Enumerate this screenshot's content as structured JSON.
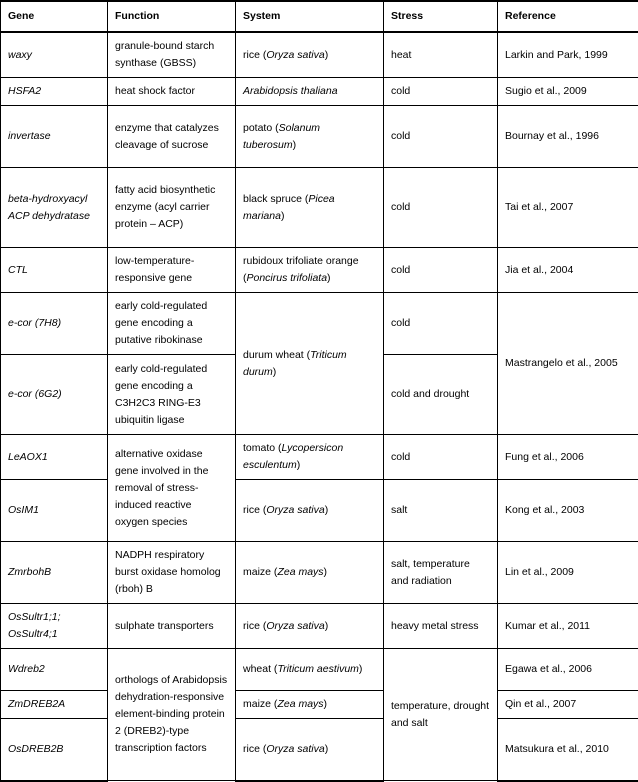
{
  "table": {
    "columns": [
      {
        "key": "gene",
        "label": "Gene"
      },
      {
        "key": "function",
        "label": "Function"
      },
      {
        "key": "system",
        "label": "System"
      },
      {
        "key": "stress",
        "label": "Stress"
      },
      {
        "key": "reference",
        "label": "Reference"
      }
    ],
    "rows": [
      {
        "gene": "waxy",
        "function": "granule-bound starch synthase (GBSS)",
        "system_plain": "rice (",
        "system_italic": "Oryza sativa",
        "system_tail": ")",
        "stress": "heat",
        "reference": "Larkin and Park, 1999"
      },
      {
        "gene": "HSFA2",
        "function": "heat shock factor",
        "system_plain": "",
        "system_italic": "Arabidopsis thaliana",
        "system_tail": "",
        "stress": "cold",
        "reference": "Sugio et al., 2009"
      },
      {
        "gene": "invertase",
        "function": "enzyme that catalyzes cleavage of sucrose",
        "system_plain": "potato (",
        "system_italic": "Solanum tuberosum",
        "system_tail": ")",
        "stress": "cold",
        "reference": "Bournay et al., 1996"
      },
      {
        "gene": "beta-hydroxyacyl ACP dehydratase",
        "function": "fatty acid biosynthetic enzyme (acyl carrier protein – ACP)",
        "system_plain": "black spruce (",
        "system_italic": "Picea mariana",
        "system_tail": ")",
        "stress": "cold",
        "reference": "Tai et al., 2007"
      },
      {
        "gene": "CTL",
        "function": "low-temperature-responsive gene",
        "system_plain": "rubidoux trifoliate orange (",
        "system_italic": "Poncirus trifoliata",
        "system_tail": ")",
        "stress": "cold",
        "reference": "Jia et al., 2004"
      },
      {
        "gene": "e-cor (7H8)",
        "function": "early cold-regulated gene encoding a putative ribokinase",
        "system_plain": "durum wheat (",
        "system_italic": "Triticum durum",
        "system_tail": ")",
        "stress": "cold",
        "reference": "Mastrangelo et al., 2005"
      },
      {
        "gene": "e-cor (6G2)",
        "function": "early cold-regulated gene encoding a C3H2C3 RING-E3 ubiquitin ligase",
        "stress": "cold and drought"
      },
      {
        "gene": "LeAOX1",
        "function": "alternative oxidase gene involved in the removal of stress-induced reactive oxygen species",
        "system_plain": "tomato (",
        "system_italic": "Lycopersicon esculentum",
        "system_tail": ")",
        "stress": "cold",
        "reference": "Fung et al., 2006"
      },
      {
        "gene": "OsIM1",
        "system_plain": "rice (",
        "system_italic": "Oryza sativa",
        "system_tail": ")",
        "stress": "salt",
        "reference": "Kong et al., 2003"
      },
      {
        "gene": "ZmrbohB",
        "function": "NADPH respiratory burst oxidase homolog (rboh) B",
        "system_plain": "maize (",
        "system_italic": "Zea mays",
        "system_tail": ")",
        "stress": "salt, temperature and radiation",
        "reference": "Lin et al., 2009"
      },
      {
        "gene": "OsSultr1;1; OsSultr4;1",
        "function": "sulphate transporters",
        "system_plain": "rice (",
        "system_italic": "Oryza sativa",
        "system_tail": ")",
        "stress": "heavy metal stress",
        "reference": "Kumar et al., 2011"
      },
      {
        "gene": "Wdreb2",
        "function": "orthologs of Arabidopsis dehydration-responsive element-binding protein 2 (DREB2)-type transcription factors",
        "system_plain": "wheat (",
        "system_italic": "Triticum aestivum",
        "system_tail": ")",
        "stress": "temperature, drought and salt",
        "reference": "Egawa et al., 2006"
      },
      {
        "gene": "ZmDREB2A",
        "system_plain": "maize (",
        "system_italic": "Zea mays",
        "system_tail": ")",
        "reference": "Qin et al., 2007"
      },
      {
        "gene": "OsDREB2B",
        "system_plain": "rice (",
        "system_italic": "Oryza sativa",
        "system_tail": ")",
        "reference": "Matsukura et al., 2010"
      }
    ]
  },
  "colors": {
    "border": "#000000",
    "text": "#000000",
    "background": "#ffffff"
  }
}
